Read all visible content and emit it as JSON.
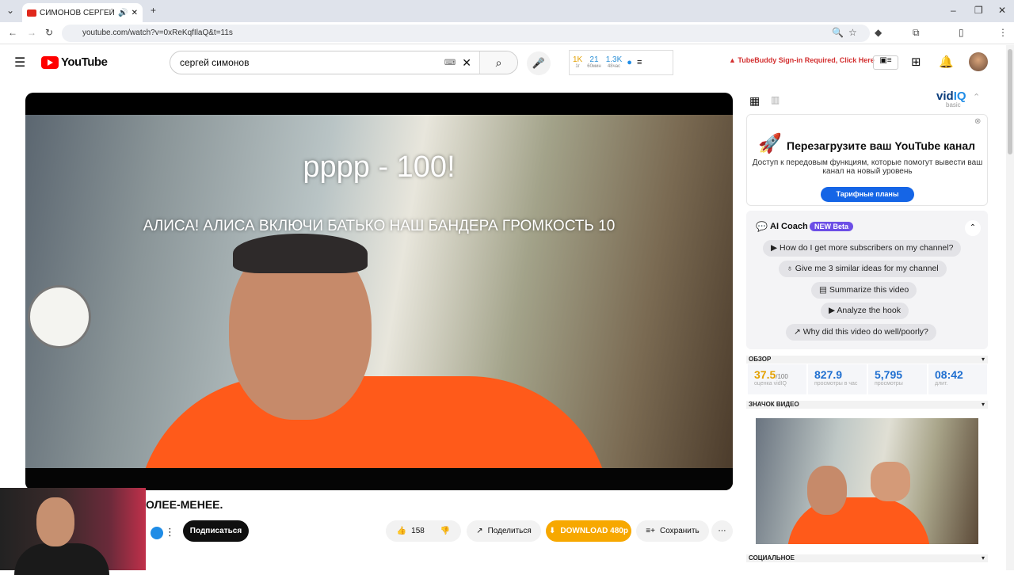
{
  "browser": {
    "tab_title": "СИМОНОВ СЕРГЕЙ - БОЛЕ",
    "url": "youtube.com/watch?v=0xReKqfIlaQ&t=11s"
  },
  "youtube": {
    "logo_text": "YouTube",
    "search_value": "сергей симонов",
    "stats": [
      {
        "value": "1K",
        "sub": "1г"
      },
      {
        "value": "21",
        "sub": "60мин"
      },
      {
        "value": "1.3K",
        "sub": "48час"
      }
    ],
    "tubebuddy_notice": "TubeBuddy Sign-in Required, Click Here"
  },
  "video": {
    "overlay_line1": "рррр - 100!",
    "overlay_line2": "АЛИСА! АЛИСА ВКЛЮЧИ БАТЬКО НАШ БАНДЕРА ГРОМКОСТЬ 10",
    "title_fragment": "ОЛЕЕ-МЕНЕЕ.",
    "subscribe_label": "Подписаться",
    "like_count": "158",
    "share_label": "Поделиться",
    "download_label": "DOWNLOAD 480p",
    "save_label": "Сохранить"
  },
  "vidiq": {
    "logo_main": "vid",
    "logo_iq": "IQ",
    "logo_sub": "basic",
    "promo_title": "Перезагрузите ваш YouTube канал",
    "promo_desc": "Доступ к передовым функциям, которые помогут вывести ваш канал на новый уровень",
    "promo_button": "Тарифные планы",
    "coach_title": "AI Coach",
    "coach_badge": "NEW Beta",
    "suggestions": [
      "How do I get more subscribers on my channel?",
      "Give me 3 similar ideas for my channel",
      "Summarize this video",
      "Analyze the hook",
      "Why did this video do well/poorly?"
    ],
    "overview_label": "ОБЗОР",
    "score": "37.5",
    "score_max": "/100",
    "score_label": "оценка vidIQ",
    "views_per_hour": "827.9",
    "views_per_hour_label": "просмотры в час",
    "views": "5,795",
    "views_label": "просмотры",
    "duration": "08:42",
    "duration_label": "длит.",
    "thumbnail_label": "ЗНАЧОК ВИДЕО",
    "social_label": "СОЦИАЛЬНОЕ"
  },
  "colors": {
    "youtube_red": "#ff0000",
    "vidiq_blue": "#1565e6",
    "download_orange": "#f7a800",
    "coach_badge": "#6c4ee6"
  }
}
